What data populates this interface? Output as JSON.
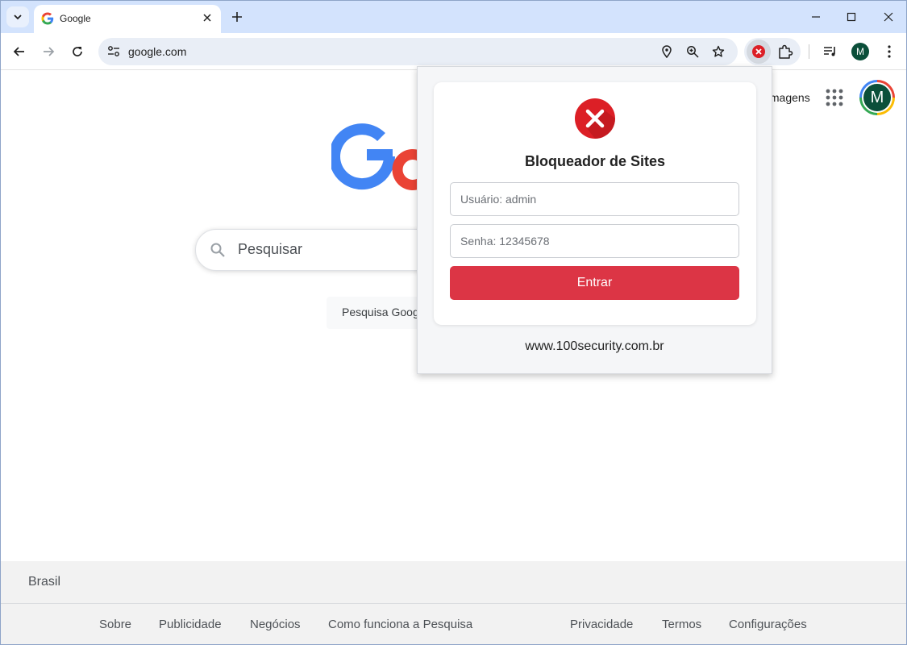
{
  "browser": {
    "tab": {
      "title": "Google"
    },
    "address": {
      "url": "google.com"
    },
    "profile_initial": "M"
  },
  "google": {
    "images_link": "Imagens",
    "avatar_initial": "M",
    "search_placeholder": "Pesquisar",
    "search_button": "Pesquisa Google",
    "footer": {
      "country": "Brasil",
      "left_links": [
        "Sobre",
        "Publicidade",
        "Negócios",
        "Como funciona a Pesquisa"
      ],
      "right_links": [
        "Privacidade",
        "Termos",
        "Configurações"
      ]
    }
  },
  "popup": {
    "title": "Bloqueador de Sites",
    "username_placeholder": "Usuário: admin",
    "password_placeholder": "Senha: 12345678",
    "login_button": "Entrar",
    "website": "www.100security.com.br"
  },
  "colors": {
    "accent_red": "#dc3545",
    "tabstrip": "#d3e3fd",
    "google_blue": "#4285f4",
    "google_red": "#ea4335"
  }
}
